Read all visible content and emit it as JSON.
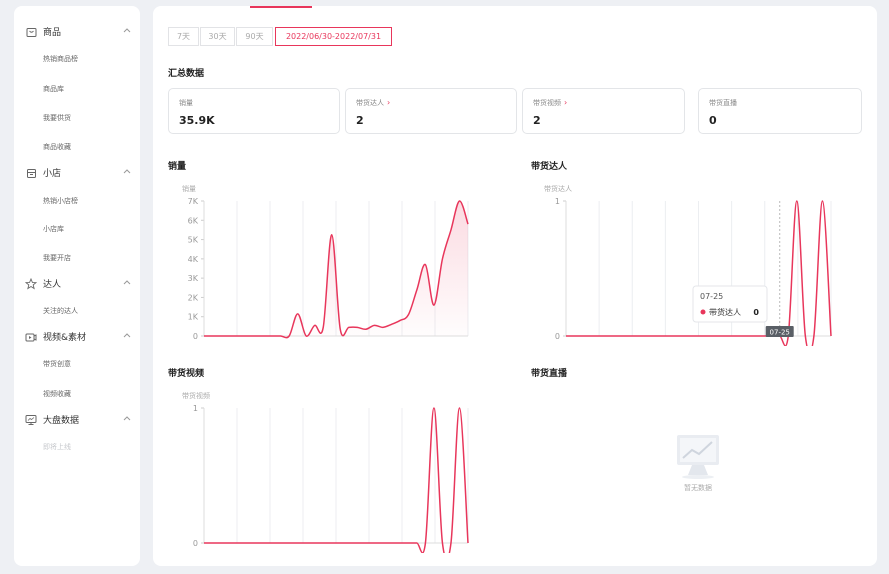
{
  "sidebar": {
    "groups": [
      {
        "label": "商品",
        "icon": "shopping-bag-icon",
        "items": [
          "热销商品榜",
          "商品库",
          "我要供货",
          "商品收藏"
        ]
      },
      {
        "label": "小店",
        "icon": "store-icon",
        "items": [
          "热销小店榜",
          "小店库",
          "我要开店"
        ]
      },
      {
        "label": "达人",
        "icon": "star-icon",
        "items": [
          "关注的达人"
        ]
      },
      {
        "label": "视频&素材",
        "icon": "video-icon",
        "items": [
          "带货创意",
          "视频收藏"
        ]
      },
      {
        "label": "大盘数据",
        "icon": "monitor-icon",
        "items": [
          "即将上线"
        ]
      }
    ]
  },
  "date_range": {
    "options": [
      "7天",
      "30天",
      "90天",
      "2022/06/30-2022/07/31"
    ],
    "selected": "2022/06/30-2022/07/31"
  },
  "summary": {
    "title": "汇总数据",
    "cards": [
      {
        "label": "销量",
        "value": "35.9K",
        "has_link": false
      },
      {
        "label": "带货达人",
        "value": "2",
        "has_link": true
      },
      {
        "label": "带货视频",
        "value": "2",
        "has_link": true
      },
      {
        "label": "带货直播",
        "value": "0",
        "has_link": false
      }
    ]
  },
  "sections": {
    "sales": "销量",
    "influencers": "带货达人",
    "videos": "带货视频",
    "live": "带货直播"
  },
  "empty_state": {
    "text": "暂无数据"
  },
  "tooltip": {
    "date": "07-25",
    "series": "带货达人",
    "value": "0"
  },
  "colors": {
    "accent": "#e8365b"
  },
  "chart_data": [
    {
      "type": "area",
      "title": "销量",
      "ylabel": "销量",
      "ylim": [
        0,
        7000
      ],
      "yticks": [
        "0",
        "1K",
        "2K",
        "3K",
        "4K",
        "5K",
        "6K",
        "7K"
      ],
      "x": [
        0,
        1,
        2,
        3,
        4,
        5,
        6,
        7,
        8,
        9,
        10,
        11,
        12,
        13,
        14,
        15,
        16,
        17,
        18,
        19,
        20,
        21,
        22,
        23,
        24,
        25,
        26,
        27,
        28,
        29,
        30,
        31
      ],
      "series": [
        {
          "name": "销量",
          "values": [
            0,
            0,
            0,
            0,
            0,
            0,
            0,
            0,
            0,
            0,
            0,
            1150,
            0,
            550,
            450,
            5250,
            350,
            450,
            450,
            350,
            550,
            450,
            600,
            800,
            1100,
            2400,
            3700,
            1600,
            4000,
            5500,
            7000,
            5800
          ]
        }
      ]
    },
    {
      "type": "line",
      "title": "带货达人",
      "ylabel": "带货达人",
      "ylim": [
        0,
        1
      ],
      "yticks": [
        "0",
        "1"
      ],
      "x": [
        0,
        1,
        2,
        3,
        4,
        5,
        6,
        7,
        8,
        9,
        10,
        11,
        12,
        13,
        14,
        15,
        16,
        17,
        18,
        19,
        20,
        21,
        22,
        23,
        24,
        25,
        26,
        27,
        28,
        29,
        30,
        31
      ],
      "series": [
        {
          "name": "带货达人",
          "values": [
            0,
            0,
            0,
            0,
            0,
            0,
            0,
            0,
            0,
            0,
            0,
            0,
            0,
            0,
            0,
            0,
            0,
            0,
            0,
            0,
            0,
            0,
            0,
            0,
            0,
            0,
            0,
            1,
            0,
            0,
            1,
            0
          ]
        }
      ],
      "tooltip_index": 25,
      "tooltip_label": "07-25"
    },
    {
      "type": "line",
      "title": "带货视频",
      "ylabel": "带货视频",
      "ylim": [
        0,
        1
      ],
      "yticks": [
        "0",
        "1"
      ],
      "x": [
        0,
        1,
        2,
        3,
        4,
        5,
        6,
        7,
        8,
        9,
        10,
        11,
        12,
        13,
        14,
        15,
        16,
        17,
        18,
        19,
        20,
        21,
        22,
        23,
        24,
        25,
        26,
        27,
        28,
        29,
        30,
        31
      ],
      "series": [
        {
          "name": "带货视频",
          "values": [
            0,
            0,
            0,
            0,
            0,
            0,
            0,
            0,
            0,
            0,
            0,
            0,
            0,
            0,
            0,
            0,
            0,
            0,
            0,
            0,
            0,
            0,
            0,
            0,
            0,
            0,
            0,
            1,
            0,
            0,
            1,
            0
          ]
        }
      ]
    }
  ]
}
